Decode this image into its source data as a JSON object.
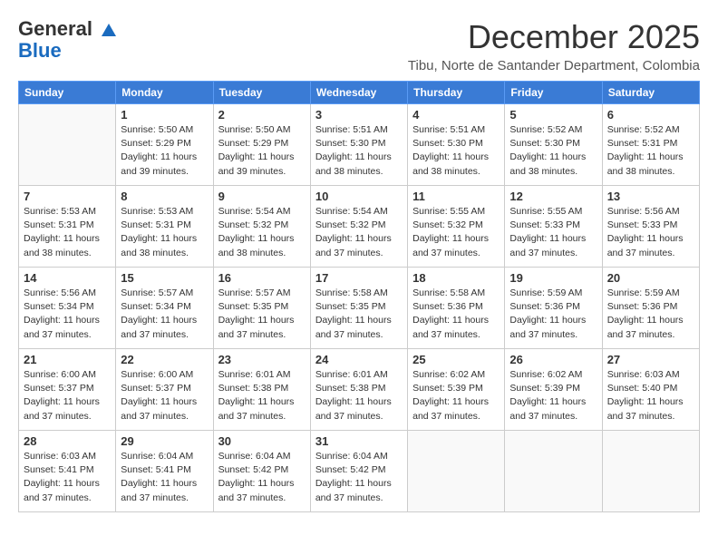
{
  "logo": {
    "line1": "General",
    "line2": "Blue"
  },
  "title": {
    "month": "December 2025",
    "location": "Tibu, Norte de Santander Department, Colombia"
  },
  "weekdays": [
    "Sunday",
    "Monday",
    "Tuesday",
    "Wednesday",
    "Thursday",
    "Friday",
    "Saturday"
  ],
  "weeks": [
    [
      {
        "day": "",
        "sunrise": "",
        "sunset": "",
        "daylight": ""
      },
      {
        "day": "1",
        "sunrise": "Sunrise: 5:50 AM",
        "sunset": "Sunset: 5:29 PM",
        "daylight": "Daylight: 11 hours and 39 minutes."
      },
      {
        "day": "2",
        "sunrise": "Sunrise: 5:50 AM",
        "sunset": "Sunset: 5:29 PM",
        "daylight": "Daylight: 11 hours and 39 minutes."
      },
      {
        "day": "3",
        "sunrise": "Sunrise: 5:51 AM",
        "sunset": "Sunset: 5:30 PM",
        "daylight": "Daylight: 11 hours and 38 minutes."
      },
      {
        "day": "4",
        "sunrise": "Sunrise: 5:51 AM",
        "sunset": "Sunset: 5:30 PM",
        "daylight": "Daylight: 11 hours and 38 minutes."
      },
      {
        "day": "5",
        "sunrise": "Sunrise: 5:52 AM",
        "sunset": "Sunset: 5:30 PM",
        "daylight": "Daylight: 11 hours and 38 minutes."
      },
      {
        "day": "6",
        "sunrise": "Sunrise: 5:52 AM",
        "sunset": "Sunset: 5:31 PM",
        "daylight": "Daylight: 11 hours and 38 minutes."
      }
    ],
    [
      {
        "day": "7",
        "sunrise": "Sunrise: 5:53 AM",
        "sunset": "Sunset: 5:31 PM",
        "daylight": "Daylight: 11 hours and 38 minutes."
      },
      {
        "day": "8",
        "sunrise": "Sunrise: 5:53 AM",
        "sunset": "Sunset: 5:31 PM",
        "daylight": "Daylight: 11 hours and 38 minutes."
      },
      {
        "day": "9",
        "sunrise": "Sunrise: 5:54 AM",
        "sunset": "Sunset: 5:32 PM",
        "daylight": "Daylight: 11 hours and 38 minutes."
      },
      {
        "day": "10",
        "sunrise": "Sunrise: 5:54 AM",
        "sunset": "Sunset: 5:32 PM",
        "daylight": "Daylight: 11 hours and 37 minutes."
      },
      {
        "day": "11",
        "sunrise": "Sunrise: 5:55 AM",
        "sunset": "Sunset: 5:32 PM",
        "daylight": "Daylight: 11 hours and 37 minutes."
      },
      {
        "day": "12",
        "sunrise": "Sunrise: 5:55 AM",
        "sunset": "Sunset: 5:33 PM",
        "daylight": "Daylight: 11 hours and 37 minutes."
      },
      {
        "day": "13",
        "sunrise": "Sunrise: 5:56 AM",
        "sunset": "Sunset: 5:33 PM",
        "daylight": "Daylight: 11 hours and 37 minutes."
      }
    ],
    [
      {
        "day": "14",
        "sunrise": "Sunrise: 5:56 AM",
        "sunset": "Sunset: 5:34 PM",
        "daylight": "Daylight: 11 hours and 37 minutes."
      },
      {
        "day": "15",
        "sunrise": "Sunrise: 5:57 AM",
        "sunset": "Sunset: 5:34 PM",
        "daylight": "Daylight: 11 hours and 37 minutes."
      },
      {
        "day": "16",
        "sunrise": "Sunrise: 5:57 AM",
        "sunset": "Sunset: 5:35 PM",
        "daylight": "Daylight: 11 hours and 37 minutes."
      },
      {
        "day": "17",
        "sunrise": "Sunrise: 5:58 AM",
        "sunset": "Sunset: 5:35 PM",
        "daylight": "Daylight: 11 hours and 37 minutes."
      },
      {
        "day": "18",
        "sunrise": "Sunrise: 5:58 AM",
        "sunset": "Sunset: 5:36 PM",
        "daylight": "Daylight: 11 hours and 37 minutes."
      },
      {
        "day": "19",
        "sunrise": "Sunrise: 5:59 AM",
        "sunset": "Sunset: 5:36 PM",
        "daylight": "Daylight: 11 hours and 37 minutes."
      },
      {
        "day": "20",
        "sunrise": "Sunrise: 5:59 AM",
        "sunset": "Sunset: 5:36 PM",
        "daylight": "Daylight: 11 hours and 37 minutes."
      }
    ],
    [
      {
        "day": "21",
        "sunrise": "Sunrise: 6:00 AM",
        "sunset": "Sunset: 5:37 PM",
        "daylight": "Daylight: 11 hours and 37 minutes."
      },
      {
        "day": "22",
        "sunrise": "Sunrise: 6:00 AM",
        "sunset": "Sunset: 5:37 PM",
        "daylight": "Daylight: 11 hours and 37 minutes."
      },
      {
        "day": "23",
        "sunrise": "Sunrise: 6:01 AM",
        "sunset": "Sunset: 5:38 PM",
        "daylight": "Daylight: 11 hours and 37 minutes."
      },
      {
        "day": "24",
        "sunrise": "Sunrise: 6:01 AM",
        "sunset": "Sunset: 5:38 PM",
        "daylight": "Daylight: 11 hours and 37 minutes."
      },
      {
        "day": "25",
        "sunrise": "Sunrise: 6:02 AM",
        "sunset": "Sunset: 5:39 PM",
        "daylight": "Daylight: 11 hours and 37 minutes."
      },
      {
        "day": "26",
        "sunrise": "Sunrise: 6:02 AM",
        "sunset": "Sunset: 5:39 PM",
        "daylight": "Daylight: 11 hours and 37 minutes."
      },
      {
        "day": "27",
        "sunrise": "Sunrise: 6:03 AM",
        "sunset": "Sunset: 5:40 PM",
        "daylight": "Daylight: 11 hours and 37 minutes."
      }
    ],
    [
      {
        "day": "28",
        "sunrise": "Sunrise: 6:03 AM",
        "sunset": "Sunset: 5:41 PM",
        "daylight": "Daylight: 11 hours and 37 minutes."
      },
      {
        "day": "29",
        "sunrise": "Sunrise: 6:04 AM",
        "sunset": "Sunset: 5:41 PM",
        "daylight": "Daylight: 11 hours and 37 minutes."
      },
      {
        "day": "30",
        "sunrise": "Sunrise: 6:04 AM",
        "sunset": "Sunset: 5:42 PM",
        "daylight": "Daylight: 11 hours and 37 minutes."
      },
      {
        "day": "31",
        "sunrise": "Sunrise: 6:04 AM",
        "sunset": "Sunset: 5:42 PM",
        "daylight": "Daylight: 11 hours and 37 minutes."
      },
      {
        "day": "",
        "sunrise": "",
        "sunset": "",
        "daylight": ""
      },
      {
        "day": "",
        "sunrise": "",
        "sunset": "",
        "daylight": ""
      },
      {
        "day": "",
        "sunrise": "",
        "sunset": "",
        "daylight": ""
      }
    ]
  ]
}
